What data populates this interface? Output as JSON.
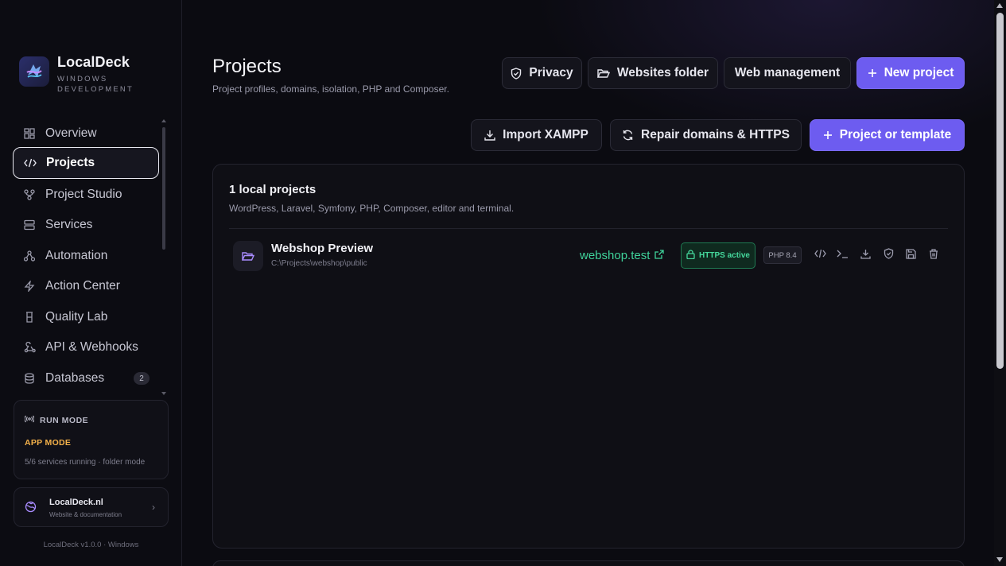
{
  "app": {
    "name": "LocalDeck",
    "subtitle_line1": "WINDOWS",
    "subtitle_line2": "DEVELOPMENT"
  },
  "sidebar": {
    "items": [
      {
        "label": "Overview",
        "icon": "grid-icon"
      },
      {
        "label": "Projects",
        "icon": "code-icon",
        "active": true
      },
      {
        "label": "Project Studio",
        "icon": "branch-icon"
      },
      {
        "label": "Services",
        "icon": "server-icon"
      },
      {
        "label": "Automation",
        "icon": "workflow-icon"
      },
      {
        "label": "Action Center",
        "icon": "bolt-icon"
      },
      {
        "label": "Quality Lab",
        "icon": "flask-icon"
      },
      {
        "label": "API & Webhooks",
        "icon": "webhook-icon"
      },
      {
        "label": "Databases",
        "icon": "database-icon",
        "badge": "2"
      }
    ],
    "run_mode": {
      "title": "RUN MODE",
      "mode": "APP MODE",
      "status": "5/6 services running · folder mode"
    },
    "site": {
      "name": "LocalDeck.nl",
      "sub": "Website & documentation"
    },
    "version": "LocalDeck v1.0.0 · Windows"
  },
  "header": {
    "title": "Projects",
    "subtitle": "Project profiles, domains, isolation, PHP and Composer.",
    "buttons": {
      "privacy": "Privacy",
      "websites_folder": "Websites folder",
      "web_management": "Web management",
      "new_project": "New project",
      "import_xampp": "Import XAMPP",
      "repair": "Repair domains & HTTPS",
      "project_or_template": "Project or template"
    }
  },
  "projects": {
    "title": "1 local projects",
    "subtitle": "WordPress, Laravel, Symfony, PHP, Composer, editor and terminal.",
    "list": [
      {
        "name": "Webshop Preview",
        "path": "C:\\Projects\\webshop\\public",
        "domain": "webshop.test",
        "https": "HTTPS active",
        "php": "PHP 8.4"
      }
    ]
  },
  "colors": {
    "accent": "#6d5cf0",
    "success": "#3fd39b",
    "warning": "#f4b14a"
  }
}
